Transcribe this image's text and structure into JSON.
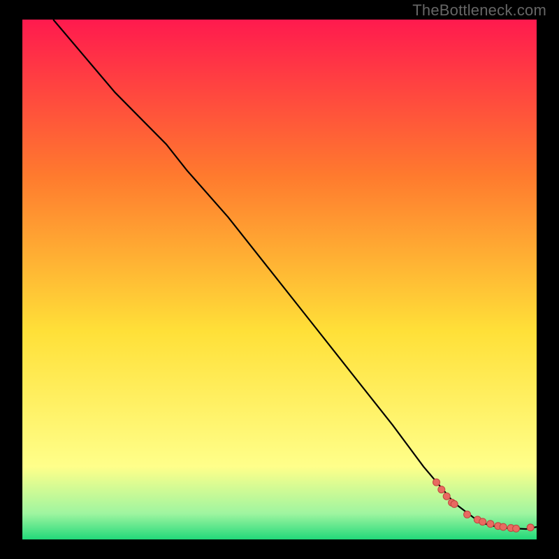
{
  "watermark": "TheBottleneck.com",
  "colors": {
    "frame": "#000000",
    "curve": "#000000",
    "marker_fill": "#e86a61",
    "marker_stroke": "#c0453e",
    "grad_top": "#ff1a4e",
    "grad_mid1": "#ff7a2e",
    "grad_mid2": "#ffe038",
    "grad_low": "#ffff8a",
    "grad_green1": "#9ff5a0",
    "grad_green2": "#22d97a"
  },
  "chart_data": {
    "type": "line",
    "title": "",
    "xlabel": "",
    "ylabel": "",
    "xlim": [
      0,
      100
    ],
    "ylim": [
      0,
      100
    ],
    "series": [
      {
        "name": "curve",
        "x": [
          6,
          12,
          18,
          24,
          28,
          32,
          40,
          48,
          56,
          64,
          72,
          78,
          84,
          88,
          90,
          92,
          94,
          96,
          98,
          100
        ],
        "y": [
          100,
          93,
          86,
          80,
          76,
          71,
          62,
          52,
          42,
          32,
          22,
          14,
          7,
          4,
          3,
          2.5,
          2.2,
          2.1,
          2.0,
          2.4
        ]
      }
    ],
    "markers": {
      "name": "highlight",
      "x": [
        80.5,
        81.5,
        82.5,
        83.5,
        84.0,
        86.5,
        88.5,
        89.5,
        91.0,
        92.5,
        93.5,
        95.0,
        96.0,
        98.8
      ],
      "y": [
        11.0,
        9.6,
        8.3,
        7.1,
        6.8,
        4.8,
        3.8,
        3.4,
        3.0,
        2.6,
        2.4,
        2.2,
        2.1,
        2.3
      ]
    },
    "gradient_bands": [
      {
        "from": 100,
        "to": 70,
        "color_top": "#ff1a4e",
        "color_bottom": "#ff7a2e"
      },
      {
        "from": 70,
        "to": 40,
        "color_top": "#ff7a2e",
        "color_bottom": "#ffe038"
      },
      {
        "from": 40,
        "to": 12,
        "color_top": "#ffe038",
        "color_bottom": "#ffff8a"
      },
      {
        "from": 12,
        "to": 3,
        "color_top": "#ffff8a",
        "color_bottom": "#9ff5a0"
      },
      {
        "from": 3,
        "to": 0,
        "color_top": "#9ff5a0",
        "color_bottom": "#22d97a"
      }
    ]
  }
}
